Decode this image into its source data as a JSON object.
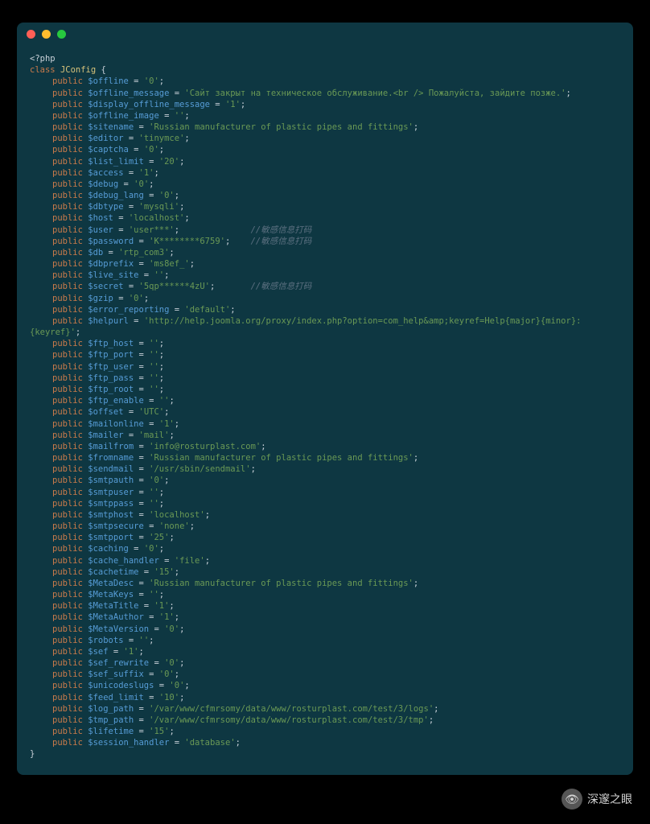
{
  "phpOpen": "<?php",
  "classKw": "class",
  "className": "JConfig",
  "openBrace": "{",
  "closeBrace": "}",
  "pub": "public",
  "lines": [
    {
      "var": "$offline",
      "val": "'0'"
    },
    {
      "var": "$offline_message",
      "val": "'Сайт закрыт на техническое обслуживание.<br /> Пожалуйста, зайдите позже.'"
    },
    {
      "var": "$display_offline_message",
      "val": "'1'"
    },
    {
      "var": "$offline_image",
      "val": "''"
    },
    {
      "var": "$sitename",
      "val": "'Russian manufacturer of plastic pipes and fittings'"
    },
    {
      "var": "$editor",
      "val": "'tinymce'"
    },
    {
      "var": "$captcha",
      "val": "'0'"
    },
    {
      "var": "$list_limit",
      "val": "'20'"
    },
    {
      "var": "$access",
      "val": "'1'"
    },
    {
      "var": "$debug",
      "val": "'0'"
    },
    {
      "var": "$debug_lang",
      "val": "'0'"
    },
    {
      "var": "$dbtype",
      "val": "'mysqli'"
    },
    {
      "var": "$host",
      "val": "'localhost'"
    },
    {
      "var": "$user",
      "val": "'user***'",
      "cmt": "//敏感信息打码"
    },
    {
      "var": "$password",
      "val": "'K********6759'",
      "cmt": "//敏感信息打码"
    },
    {
      "var": "$db",
      "val": "'rtp_com3'"
    },
    {
      "var": "$dbprefix",
      "val": "'ms8ef_'"
    },
    {
      "var": "$live_site",
      "val": "''"
    },
    {
      "var": "$secret",
      "val": "'5qp******4zU'",
      "cmt": "//敏感信息打码"
    },
    {
      "var": "$gzip",
      "val": "'0'"
    },
    {
      "var": "$error_reporting",
      "val": "'default'"
    },
    {
      "var": "$helpurl",
      "val": "'http://help.joomla.org/proxy/index.php?option=com_help&amp;keyref=Help{major}{minor}:{keyref}'",
      "wrap": true
    },
    {
      "var": "$ftp_host",
      "val": "''"
    },
    {
      "var": "$ftp_port",
      "val": "''"
    },
    {
      "var": "$ftp_user",
      "val": "''"
    },
    {
      "var": "$ftp_pass",
      "val": "''"
    },
    {
      "var": "$ftp_root",
      "val": "''"
    },
    {
      "var": "$ftp_enable",
      "val": "''"
    },
    {
      "var": "$offset",
      "val": "'UTC'"
    },
    {
      "var": "$mailonline",
      "val": "'1'"
    },
    {
      "var": "$mailer",
      "val": "'mail'"
    },
    {
      "var": "$mailfrom",
      "val": "'info@rosturplast.com'"
    },
    {
      "var": "$fromname",
      "val": "'Russian manufacturer of plastic pipes and fittings'"
    },
    {
      "var": "$sendmail",
      "val": "'/usr/sbin/sendmail'"
    },
    {
      "var": "$smtpauth",
      "val": "'0'"
    },
    {
      "var": "$smtpuser",
      "val": "''"
    },
    {
      "var": "$smtppass",
      "val": "''"
    },
    {
      "var": "$smtphost",
      "val": "'localhost'"
    },
    {
      "var": "$smtpsecure",
      "val": "'none'"
    },
    {
      "var": "$smtpport",
      "val": "'25'"
    },
    {
      "var": "$caching",
      "val": "'0'"
    },
    {
      "var": "$cache_handler",
      "val": "'file'"
    },
    {
      "var": "$cachetime",
      "val": "'15'"
    },
    {
      "var": "$MetaDesc",
      "val": "'Russian manufacturer of plastic pipes and fittings'"
    },
    {
      "var": "$MetaKeys",
      "val": "''"
    },
    {
      "var": "$MetaTitle",
      "val": "'1'"
    },
    {
      "var": "$MetaAuthor",
      "val": "'1'"
    },
    {
      "var": "$MetaVersion",
      "val": "'0'"
    },
    {
      "var": "$robots",
      "val": "''"
    },
    {
      "var": "$sef",
      "val": "'1'"
    },
    {
      "var": "$sef_rewrite",
      "val": "'0'"
    },
    {
      "var": "$sef_suffix",
      "val": "'0'"
    },
    {
      "var": "$unicodeslugs",
      "val": "'0'"
    },
    {
      "var": "$feed_limit",
      "val": "'10'"
    },
    {
      "var": "$log_path",
      "val": "'/var/www/cfmrsomy/data/www/rosturplast.com/test/3/logs'"
    },
    {
      "var": "$tmp_path",
      "val": "'/var/www/cfmrsomy/data/www/rosturplast.com/test/3/tmp'"
    },
    {
      "var": "$lifetime",
      "val": "'15'"
    },
    {
      "var": "$session_handler",
      "val": "'database'"
    }
  ],
  "watermark": "深邃之眼",
  "wmicon": "👁"
}
